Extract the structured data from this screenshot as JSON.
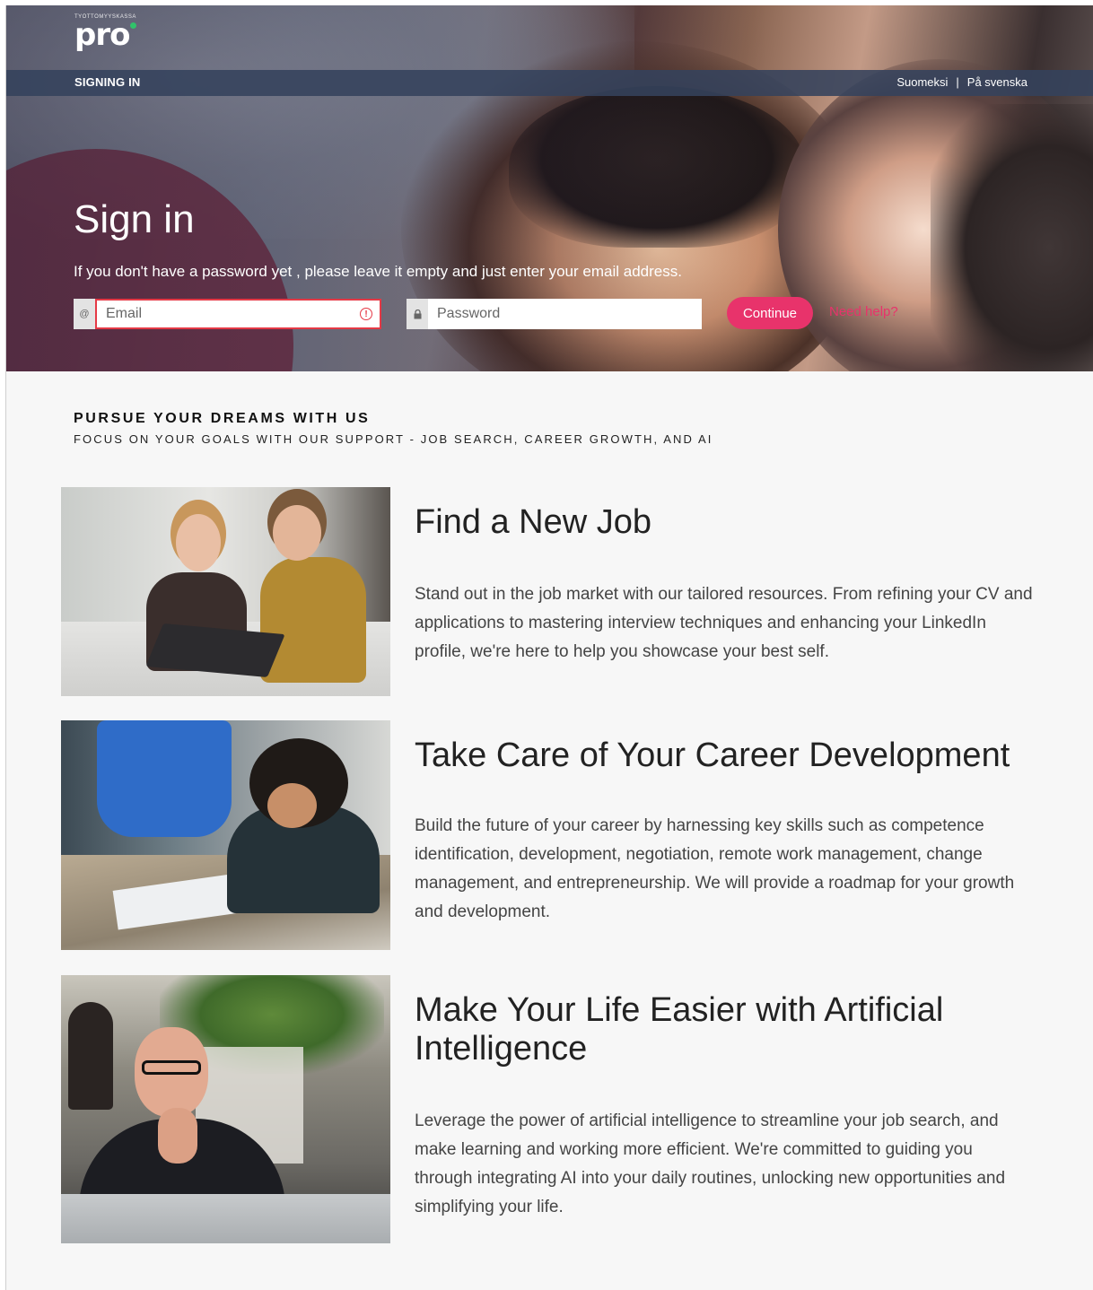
{
  "brand": {
    "tagline_small": "TYÖTTÖMYYSKASSA",
    "logo_text": "pro"
  },
  "nav": {
    "crumb": "SIGNING IN",
    "lang_fi": "Suomeksi",
    "separator": "|",
    "lang_sv": "På svenska"
  },
  "signin": {
    "title": "Sign in",
    "subtitle": "If you don't have a password yet , please leave it empty and just enter your email address.",
    "email_placeholder": "Email",
    "email_value": "",
    "email_has_error": true,
    "password_placeholder": "Password",
    "password_value": "",
    "continue_label": "Continue",
    "help_label": "Need help?"
  },
  "section": {
    "heading": "PURSUE YOUR DREAMS WITH US",
    "subheading": "FOCUS ON YOUR GOALS WITH OUR SUPPORT - JOB SEARCH, CAREER GROWTH, AND AI"
  },
  "cards": [
    {
      "title": "Find a New Job",
      "description": "Stand out in the job market with our tailored resources. From refining your CV and applications to mastering interview techniques and enhancing your LinkedIn profile, we're here to help you showcase your best self."
    },
    {
      "title": "Take Care of Your Career Development",
      "description": "Build the future of your career by harnessing key skills such as competence identification, development, negotiation, remote work management, change management, and entrepreneurship. We will provide a roadmap for your growth and development."
    },
    {
      "title": "Make Your Life Easier with Artificial Intelligence",
      "description": "Leverage the power of artificial intelligence to streamline your job search, and make learning and working more efficient. We're committed to guiding you through integrating AI into your daily routines, unlocking new opportunities and simplifying your life."
    }
  ],
  "colors": {
    "accent_pink": "#e8336b",
    "error_red": "#e53946",
    "navbar": "#34425c",
    "logo_dot_green": "#31c26a"
  },
  "icons": {
    "email_prefix": "at-icon",
    "email_error": "alert-circle-icon",
    "password_prefix": "lock-icon"
  }
}
